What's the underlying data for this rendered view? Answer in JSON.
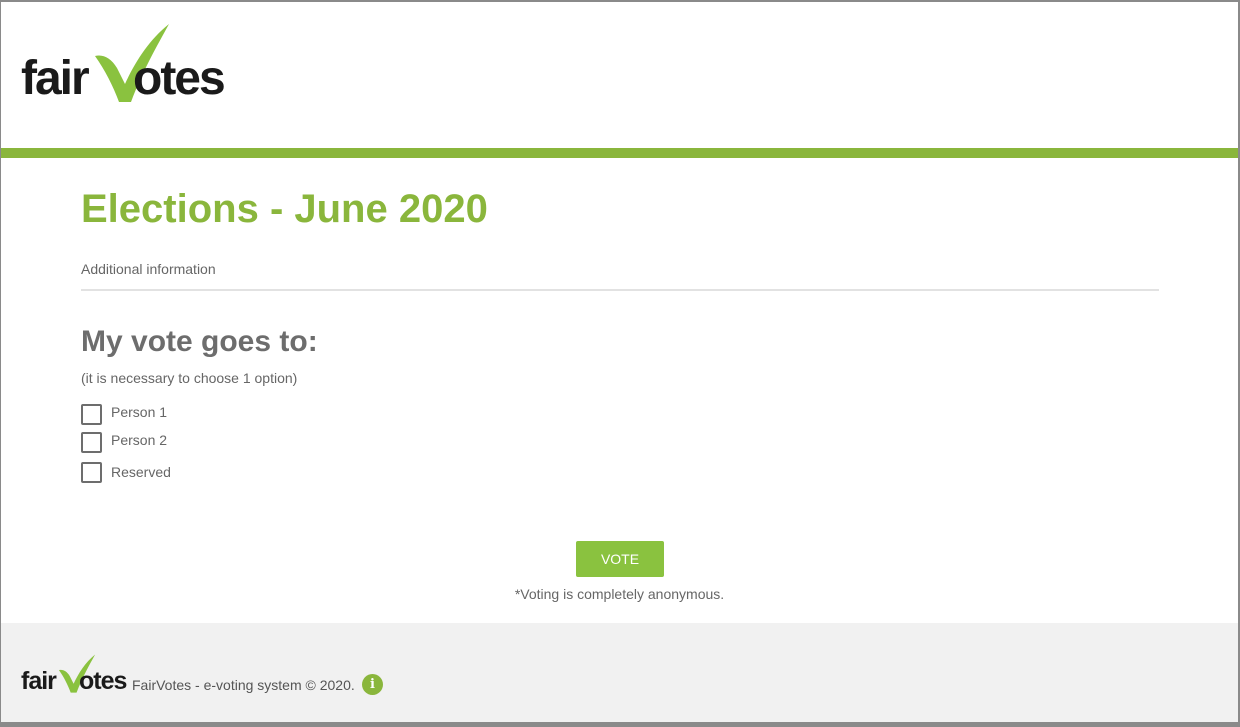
{
  "brand": {
    "logo_part1": "fair",
    "logo_part2": "otes",
    "accent_color": "#8ab63c"
  },
  "main": {
    "title": "Elections - June 2020",
    "additional_info": "Additional information",
    "vote_heading": "My vote goes to:",
    "vote_hint": "(it is necessary to choose 1 option)",
    "options": [
      {
        "label": "Person 1",
        "checked": false
      },
      {
        "label": "Person 2",
        "checked": false
      },
      {
        "label": "Reserved",
        "checked": false
      }
    ],
    "vote_button_label": "VOTE",
    "anonymous_note": "*Voting is completely anonymous."
  },
  "footer": {
    "text": "FairVotes - e-voting system © 2020.",
    "info_icon_glyph": "i",
    "info_icon": "info-icon"
  }
}
